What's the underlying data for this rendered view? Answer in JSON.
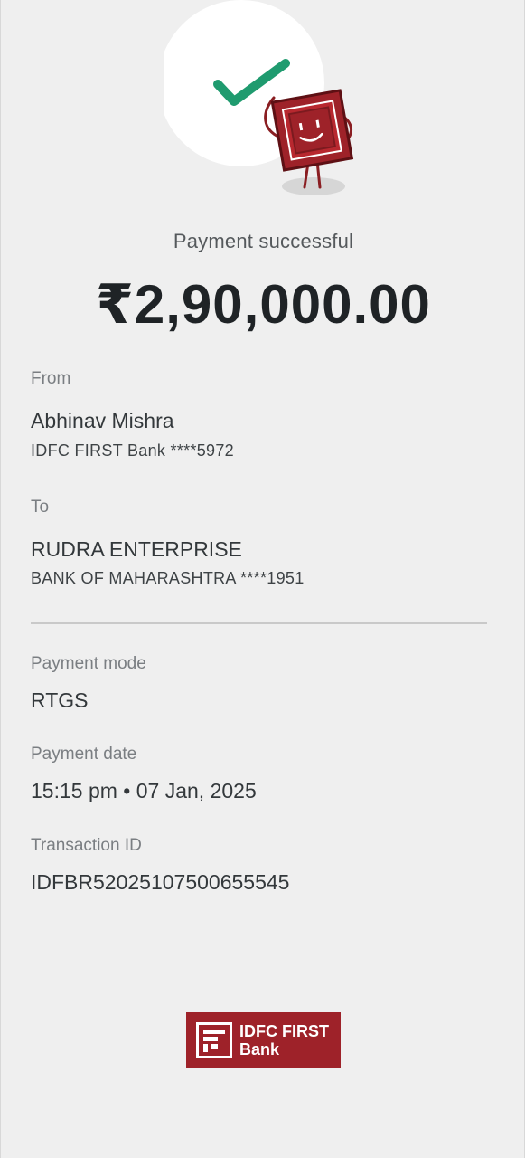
{
  "status": {
    "message": "Payment successful",
    "amount": "₹2,90,000.00"
  },
  "from": {
    "label": "From",
    "name": "Abhinav Mishra",
    "account": "IDFC FIRST Bank ****5972"
  },
  "to": {
    "label": "To",
    "name": "RUDRA ENTERPRISE",
    "account": "BANK OF MAHARASHTRA ****1951"
  },
  "payment_mode": {
    "label": "Payment mode",
    "value": "RTGS"
  },
  "payment_date": {
    "label": "Payment date",
    "value": "15:15 pm • 07 Jan, 2025"
  },
  "transaction": {
    "label": "Transaction ID",
    "value": "IDFBR52025107500655545"
  },
  "brand": {
    "line1": "IDFC FIRST",
    "line2": "Bank",
    "color": "#9e2229"
  },
  "icons": {
    "hero": "success-mascot-illustration",
    "check": "checkmark-icon",
    "logo": "idfc-first-bank-logo"
  },
  "colors": {
    "background": "#efefef",
    "check": "#1f9b6f",
    "brand": "#9e2229"
  }
}
